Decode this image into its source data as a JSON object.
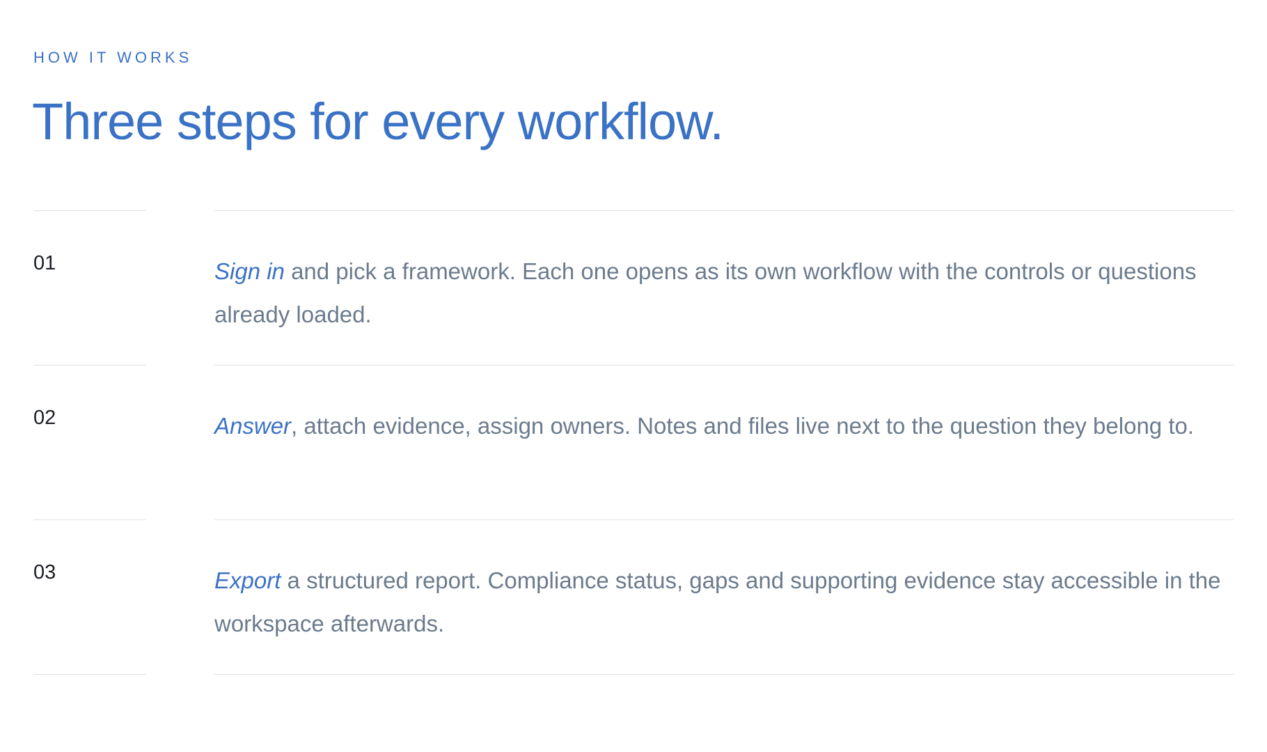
{
  "eyebrow": "HOW IT WORKS",
  "headline": "Three steps for every workflow.",
  "steps": [
    {
      "number": "01",
      "lead": "Sign in",
      "text": " and pick a framework. Each one opens as its own workflow with the controls or questions already loaded."
    },
    {
      "number": "02",
      "lead": "Answer",
      "text": ", attach evidence, assign owners. Notes and files live next to the question they belong to."
    },
    {
      "number": "03",
      "lead": "Export",
      "text": " a structured report. Compliance status, gaps and supporting evidence stay accessible in the workspace afterwards."
    }
  ],
  "colors": {
    "accent": "#3a72c6",
    "body_text": "#6b7b8d",
    "number_text": "#1b1f24",
    "rule": "#dde2e8"
  }
}
